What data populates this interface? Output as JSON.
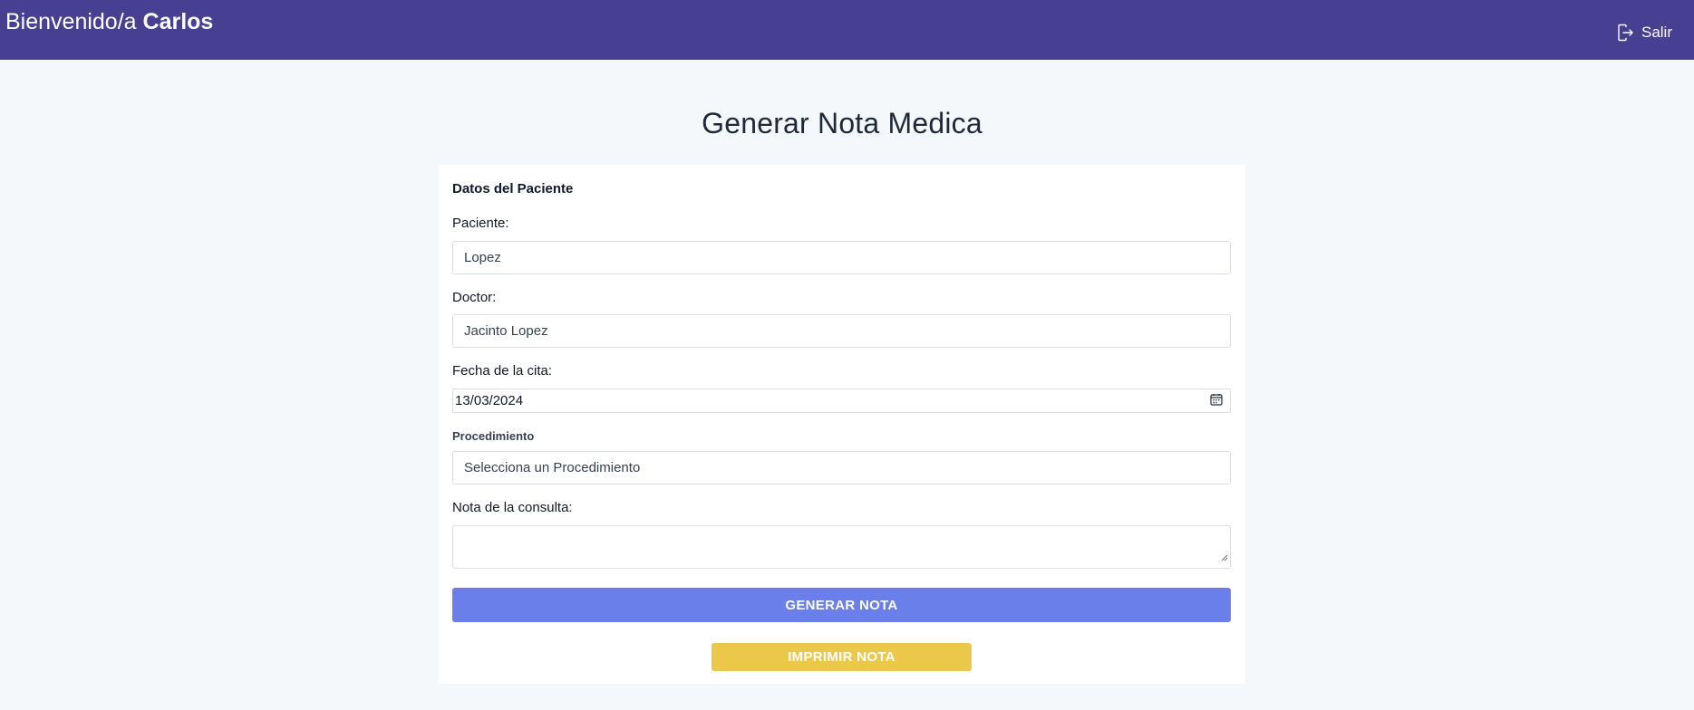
{
  "header": {
    "welcome_prefix": "Bienvenido/a",
    "user_name": "Carlos",
    "logout_label": "Salir",
    "background_color": "#463f92"
  },
  "page": {
    "title": "Generar Nota Medica"
  },
  "form": {
    "section_title": "Datos del Paciente",
    "patient": {
      "label": "Paciente:",
      "value": "Lopez"
    },
    "doctor": {
      "label": "Doctor:",
      "value": "Jacinto Lopez"
    },
    "date": {
      "label": "Fecha de la cita:",
      "value": "13/03/2024"
    },
    "procedure": {
      "label": "Procedimiento",
      "selected": "Selecciona un Procedimiento"
    },
    "note": {
      "label": "Nota de la consulta:",
      "value": ""
    },
    "generate_button": "GENERAR NOTA",
    "print_button": "IMPRIMIR NOTA"
  },
  "colors": {
    "generate_button": "#6a7fea",
    "print_button": "#ecc84a"
  },
  "icons": {
    "logout": "logout-icon",
    "calendar": "calendar-icon",
    "resize": "resize-grip-icon"
  }
}
